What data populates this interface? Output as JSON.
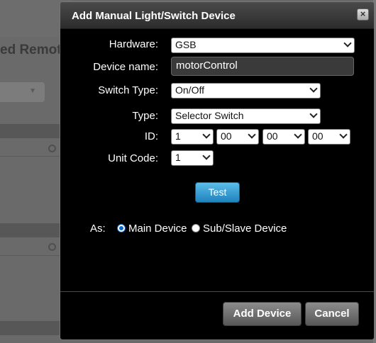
{
  "background": {
    "title_fragment": "ed Remot"
  },
  "dialog": {
    "title": "Add Manual Light/Switch Device",
    "close_glyph": "×",
    "hardware": {
      "label": "Hardware:",
      "value": "GSB"
    },
    "device_name": {
      "label": "Device name:",
      "value": "motorControl"
    },
    "switch_type": {
      "label": "Switch Type:",
      "value": "On/Off"
    },
    "type": {
      "label": "Type:",
      "value": "Selector Switch"
    },
    "id": {
      "label": "ID:",
      "values": [
        "1",
        "00",
        "00",
        "00"
      ]
    },
    "unit_code": {
      "label": "Unit Code:",
      "value": "1"
    },
    "test_label": "Test",
    "as_label": "As:",
    "as_options": [
      {
        "label": "Main Device",
        "selected": true
      },
      {
        "label": "Sub/Slave Device",
        "selected": false
      }
    ],
    "add_device_label": "Add Device",
    "cancel_label": "Cancel"
  },
  "colors": {
    "dialog_bg": "#000000",
    "accent_blue": "#1f82bd"
  }
}
